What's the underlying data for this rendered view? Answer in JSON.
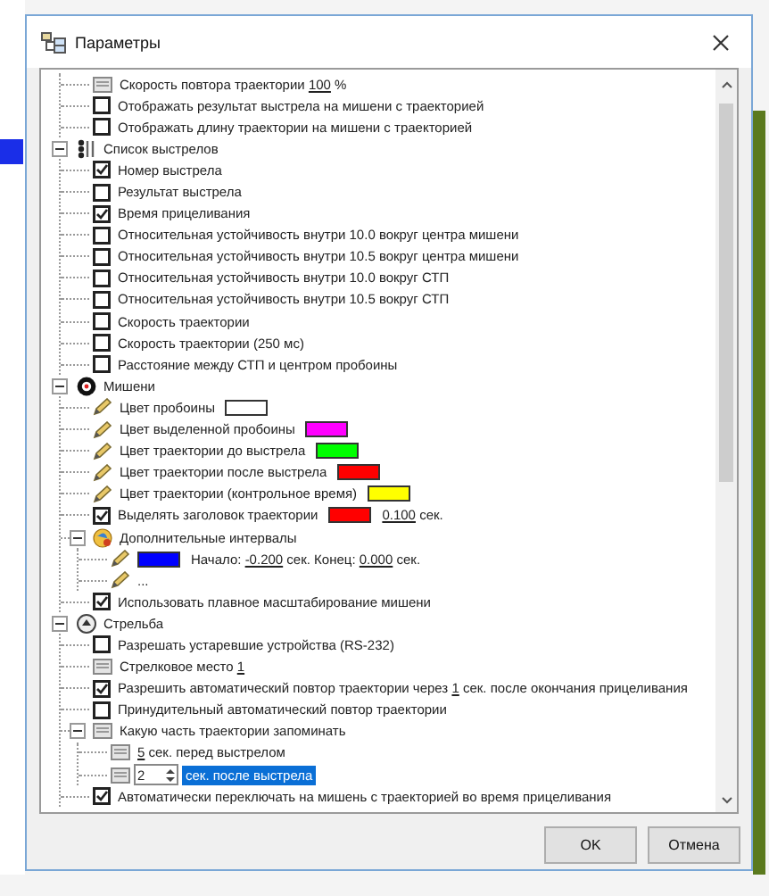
{
  "window": {
    "title": "Параметры"
  },
  "tree": {
    "continued": [
      {
        "kind": "field",
        "selected": false,
        "label": [
          {
            "text": "Скорость повтора траектории "
          },
          {
            "text": "100",
            "editable": true
          },
          {
            "text": " %"
          }
        ]
      },
      {
        "kind": "checkbox",
        "checked": false,
        "selected": false,
        "label": [
          {
            "text": "Отображать результат выстрела на мишени с траекторией"
          }
        ]
      },
      {
        "kind": "checkbox",
        "checked": false,
        "selected": false,
        "label": [
          {
            "text": "Отображать длину траектории на мишени с траекторией"
          }
        ]
      }
    ],
    "items": [
      {
        "kind": "listgroup",
        "expanded": true,
        "selected": false,
        "label": [
          {
            "text": "Список выстрелов"
          }
        ],
        "children": [
          {
            "kind": "checkbox",
            "checked": true,
            "selected": false,
            "label": [
              {
                "text": "Номер выстрела"
              }
            ]
          },
          {
            "kind": "checkbox",
            "checked": false,
            "selected": false,
            "label": [
              {
                "text": "Результат выстрела"
              }
            ]
          },
          {
            "kind": "checkbox",
            "checked": true,
            "selected": false,
            "label": [
              {
                "text": "Время прицеливания"
              }
            ]
          },
          {
            "kind": "checkbox",
            "checked": false,
            "selected": false,
            "label": [
              {
                "text": "Относительная устойчивость внутри 10.0 вокруг центра мишени"
              }
            ]
          },
          {
            "kind": "checkbox",
            "checked": false,
            "selected": false,
            "label": [
              {
                "text": "Относительная устойчивость внутри 10.5 вокруг центра мишени"
              }
            ]
          },
          {
            "kind": "checkbox",
            "checked": false,
            "selected": false,
            "label": [
              {
                "text": "Относительная устойчивость внутри 10.0 вокруг СТП"
              }
            ]
          },
          {
            "kind": "checkbox",
            "checked": false,
            "selected": false,
            "label": [
              {
                "text": "Относительная устойчивость внутри 10.5 вокруг СТП"
              }
            ]
          },
          {
            "kind": "checkbox",
            "checked": false,
            "selected": false,
            "label": [
              {
                "text": "Скорость траектории"
              }
            ]
          },
          {
            "kind": "checkbox",
            "checked": false,
            "selected": false,
            "label": [
              {
                "text": "Скорость траектории (250 мс)"
              }
            ]
          },
          {
            "kind": "checkbox",
            "checked": false,
            "selected": false,
            "label": [
              {
                "text": "Расстояние между СТП и центром пробоины"
              }
            ]
          }
        ]
      },
      {
        "kind": "targetgroup",
        "expanded": true,
        "selected": false,
        "label": [
          {
            "text": "Мишени"
          }
        ],
        "children": [
          {
            "kind": "pencil",
            "selected": false,
            "label": [
              {
                "text": "Цвет пробоины"
              },
              {
                "color": "#ffffff"
              }
            ]
          },
          {
            "kind": "pencil",
            "selected": false,
            "label": [
              {
                "text": "Цвет выделенной пробоины"
              },
              {
                "color": "#ff00ff"
              }
            ]
          },
          {
            "kind": "pencil",
            "selected": false,
            "label": [
              {
                "text": "Цвет траектории до выстрела"
              },
              {
                "color": "#00ff00"
              }
            ]
          },
          {
            "kind": "pencil",
            "selected": false,
            "label": [
              {
                "text": "Цвет траектории после выстрела"
              },
              {
                "color": "#ff0000"
              }
            ]
          },
          {
            "kind": "pencil",
            "selected": false,
            "label": [
              {
                "text": "Цвет траектории (контрольное время)"
              },
              {
                "color": "#ffff00"
              }
            ]
          },
          {
            "kind": "checkbox",
            "checked": true,
            "selected": false,
            "label": [
              {
                "text": "Выделять заголовок траектории"
              },
              {
                "color": "#ff0000"
              },
              {
                "text": "0.100",
                "editable": true
              },
              {
                "text": " сек."
              }
            ]
          },
          {
            "kind": "globegroup",
            "expanded": true,
            "selected": false,
            "label": [
              {
                "text": "Дополнительные интервалы"
              }
            ],
            "children": [
              {
                "kind": "pencil",
                "selected": false,
                "label": [
                  {
                    "color": "#0000ff"
                  },
                  {
                    "text": "Начало: "
                  },
                  {
                    "text": "-0.200",
                    "editable": true
                  },
                  {
                    "text": " сек. Конец: "
                  },
                  {
                    "text": "0.000",
                    "editable": true
                  },
                  {
                    "text": " сек."
                  }
                ]
              },
              {
                "kind": "pencil",
                "selected": false,
                "label": [
                  {
                    "text": "..."
                  }
                ]
              }
            ]
          },
          {
            "kind": "checkbox",
            "checked": true,
            "selected": false,
            "label": [
              {
                "text": "Использовать плавное масштабирование мишени"
              }
            ]
          }
        ]
      },
      {
        "kind": "roundgroup",
        "expanded": true,
        "selected": false,
        "label": [
          {
            "text": "Стрельба"
          }
        ],
        "children": [
          {
            "kind": "checkbox",
            "checked": false,
            "selected": false,
            "label": [
              {
                "text": "Разрешать устаревшие устройства (RS-232)"
              }
            ]
          },
          {
            "kind": "field",
            "selected": false,
            "label": [
              {
                "text": "Стрелковое место "
              },
              {
                "text": "1",
                "editable": true
              }
            ]
          },
          {
            "kind": "checkbox",
            "checked": true,
            "selected": false,
            "label": [
              {
                "text": "Разрешить автоматический повтор траектории через "
              },
              {
                "text": "1",
                "editable": true
              },
              {
                "text": " сек. после окончания прицеливания"
              }
            ]
          },
          {
            "kind": "checkbox",
            "checked": false,
            "selected": false,
            "label": [
              {
                "text": "Принудительный автоматический повтор траектории"
              }
            ]
          },
          {
            "kind": "fieldgroup",
            "expanded": true,
            "selected": false,
            "label": [
              {
                "text": "Какую часть траектории запоминать"
              }
            ],
            "children": [
              {
                "kind": "field",
                "selected": false,
                "label": [
                  {
                    "text": "5",
                    "editable": true
                  },
                  {
                    "text": " сек. перед выстрелом"
                  }
                ]
              },
              {
                "kind": "spin",
                "value": "2",
                "selected": true,
                "label": [
                  {
                    "text": "сек. после выстрела"
                  }
                ]
              }
            ]
          },
          {
            "kind": "checkbox",
            "checked": true,
            "selected": false,
            "label": [
              {
                "text": "Автоматически переключать на мишень с траекторией во время прицеливания"
              }
            ]
          }
        ]
      }
    ]
  },
  "buttons": [
    {
      "label": "OK"
    },
    {
      "label": "Отмена"
    }
  ]
}
